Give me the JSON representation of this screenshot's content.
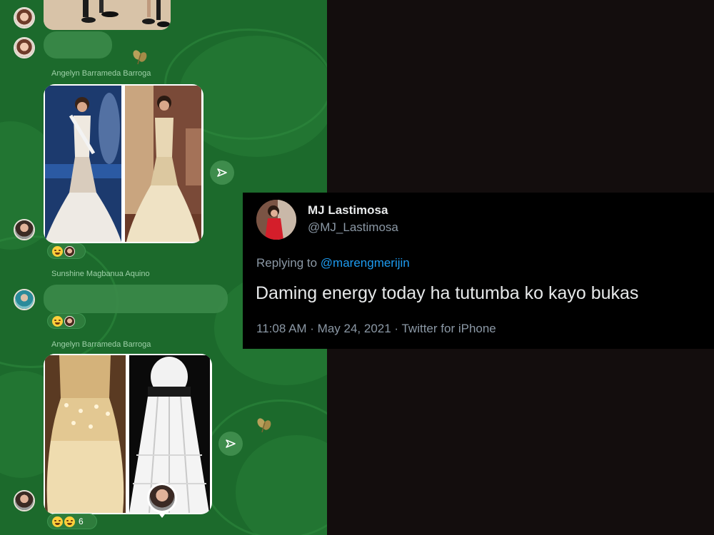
{
  "chat": {
    "messages": [
      {
        "sender": "",
        "type": "image"
      },
      {
        "sender": "",
        "type": "text"
      },
      {
        "sender": "Angelyn Barrameda Barroga",
        "type": "image-pair"
      },
      {
        "sender": "Sunshine Magbanua Aquino",
        "type": "text"
      },
      {
        "sender": "Angelyn Barrameda Barroga",
        "type": "image-pair"
      }
    ],
    "reactions": [
      {
        "icons": [
          "laughing-emoji",
          "avatar"
        ],
        "count": ""
      },
      {
        "icons": [
          "laughing-emoji",
          "avatar"
        ],
        "count": ""
      },
      {
        "icons": [
          "laughing-emoji",
          "grinning-emoji"
        ],
        "count": "6"
      }
    ],
    "colors": {
      "background": "#1c6a2c",
      "bubble": "#3b8a49",
      "name": "#9fd1a9"
    },
    "icons": [
      "share-icon",
      "leaf-sticker-icon"
    ]
  },
  "tweet": {
    "display_name": "MJ Lastimosa",
    "handle": "@MJ_Lastimosa",
    "replying_prefix": "Replying to",
    "replying_to": "@marengmerijin",
    "text": "Daming energy today ha tutumba ko kayo bukas",
    "meta": "11:08 AM · May 24, 2021 · Twitter for iPhone",
    "colors": {
      "background": "#000000",
      "text": "#e7e9ea",
      "secondary": "#8b98a5",
      "link": "#1d9bf0"
    }
  }
}
